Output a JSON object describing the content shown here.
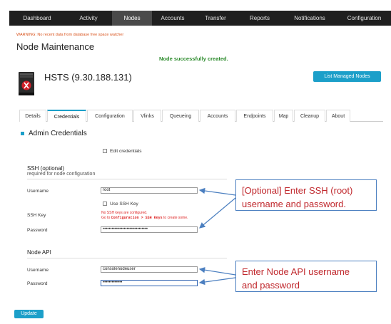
{
  "nav": {
    "items": [
      {
        "label": "Dashboard"
      },
      {
        "label": "Activity"
      },
      {
        "label": "Nodes"
      },
      {
        "label": "Accounts"
      },
      {
        "label": "Transfer"
      },
      {
        "label": "Reports"
      },
      {
        "label": "Notifications"
      },
      {
        "label": "Configuration"
      }
    ],
    "active": "Nodes"
  },
  "warning": "WARNING: No recent data from database free space watcher",
  "page_title": "Node Maintenance",
  "success_message": "Node successfully created.",
  "node": {
    "title": "HSTS (9.30.188.131)",
    "icon": "server-icon"
  },
  "list_nodes_button": "List Managed Nodes",
  "tabs": {
    "items": [
      {
        "label": "Details"
      },
      {
        "label": "Credentials"
      },
      {
        "label": "Configuration"
      },
      {
        "label": "Vlinks"
      },
      {
        "label": "Queueing"
      },
      {
        "label": "Accounts"
      },
      {
        "label": "Endpoints"
      },
      {
        "label": "Map"
      },
      {
        "label": "Cleanup"
      },
      {
        "label": "About"
      }
    ],
    "active": "Credentials"
  },
  "section_title": "Admin Credentials",
  "edit_credentials_label": "Edit credentials",
  "ssh": {
    "title": "SSH (optional)",
    "subtitle": "required for node configuration",
    "username_label": "Username",
    "username_value": "root",
    "use_ssh_key_label": "Use SSH Key",
    "ssh_key_label": "SSH Key",
    "ssh_key_error_line1": "No SSH keys are configured.",
    "ssh_key_error_go": "Go to",
    "ssh_key_error_path": "Configuration > SSH Keys",
    "ssh_key_error_end": "to create some.",
    "password_label": "Password",
    "password_value": "••••••••••••••••••••••••••••••"
  },
  "node_api": {
    "title": "Node API",
    "username_label": "Username",
    "username_value": "consolenodeuser",
    "password_label": "Password",
    "password_value": "•••••••••••••"
  },
  "update_button": "Update",
  "callouts": {
    "ssh_line1": "[Optional] Enter SSH (root)",
    "ssh_line2": "username and password.",
    "api_line1": "Enter Node API username",
    "api_line2": "and password"
  },
  "colors": {
    "accent": "#1c9fc9",
    "success": "#2a8a2a",
    "warning": "#d9541e",
    "callout_text": "#c0282d",
    "callout_border": "#4b7fc0"
  }
}
